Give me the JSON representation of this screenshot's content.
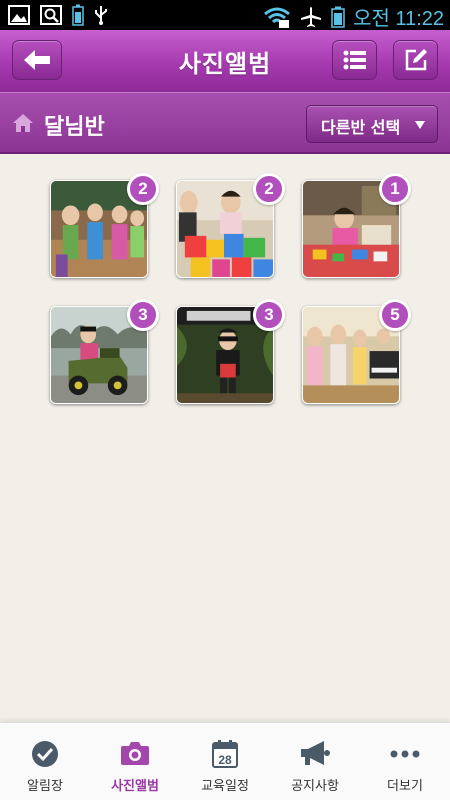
{
  "status_bar": {
    "time": "오전 11:22",
    "icons": [
      "gallery-icon",
      "search-icon",
      "battery-saver-icon",
      "usb-icon",
      "wifi-icon",
      "airplane-mode-icon",
      "battery-icon"
    ]
  },
  "header": {
    "title": "사진앨범",
    "back_icon": "back-arrow-icon",
    "list_icon": "list-icon",
    "edit_icon": "edit-icon"
  },
  "class_bar": {
    "class_name": "달님반",
    "select_label": "다른반 선택"
  },
  "albums": [
    {
      "count": "2",
      "scene": "children lined up in classroom"
    },
    {
      "count": "2",
      "scene": "child with foam blocks"
    },
    {
      "count": "1",
      "scene": "child at craft table"
    },
    {
      "count": "3",
      "scene": "child in toy jeep"
    },
    {
      "count": "3",
      "scene": "child in sunglasses outdoors"
    },
    {
      "count": "5",
      "scene": "children playing instruments"
    }
  ],
  "tabs": [
    {
      "label": "알림장",
      "icon": "check-circle-icon",
      "active": false
    },
    {
      "label": "사진앨범",
      "icon": "camera-icon",
      "active": true
    },
    {
      "label": "교육일정",
      "icon": "calendar-icon",
      "active": false
    },
    {
      "label": "공지사항",
      "icon": "megaphone-icon",
      "active": false
    },
    {
      "label": "더보기",
      "icon": "more-dots-icon",
      "active": false
    }
  ],
  "calendar_day": "28",
  "colors": {
    "accent": "#a53aae",
    "background": "#f2efe9",
    "badge": "#b14fbd",
    "time": "#5bc2e7"
  }
}
